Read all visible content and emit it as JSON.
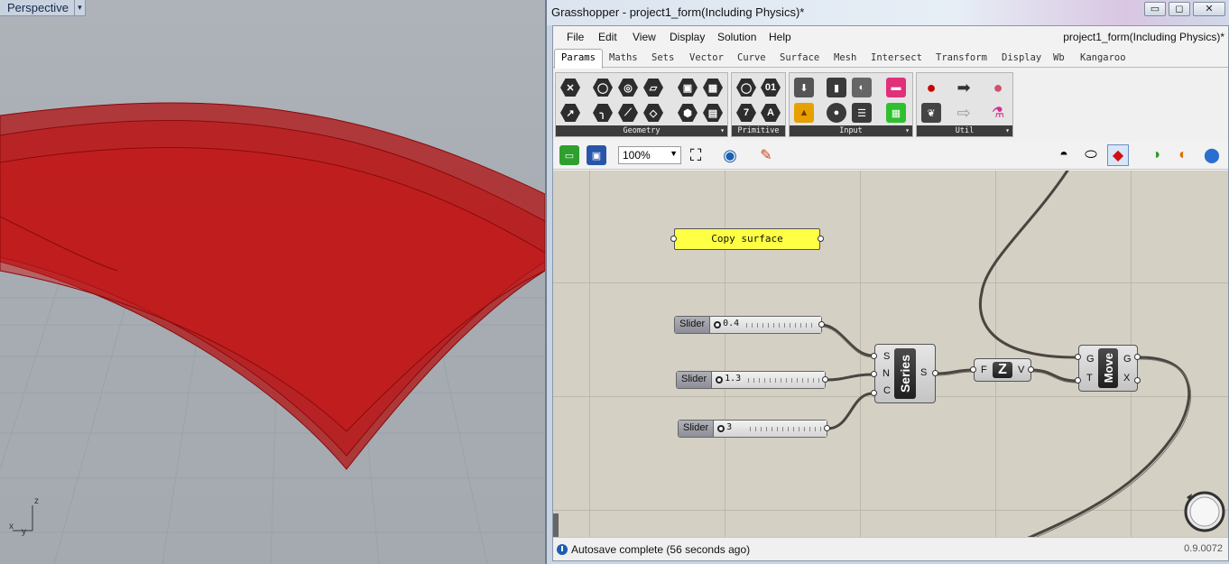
{
  "viewport": {
    "name": "Perspective",
    "dropdown_icon": "triangle-down",
    "axes": {
      "z": "z",
      "x": "x",
      "y": "y"
    },
    "surface_color": "#b01010"
  },
  "grasshopper": {
    "title": "Grasshopper - project1_form(Including Physics)*",
    "window_buttons": {
      "minimize": "▭",
      "maximize": "◻",
      "close": "✕"
    },
    "menu": [
      "File",
      "Edit",
      "View",
      "Display",
      "Solution",
      "Help"
    ],
    "document_name": "project1_form(Including Physics)*",
    "tabs": [
      "Params",
      "Maths",
      "Sets",
      "Vector",
      "Curve",
      "Surface",
      "Mesh",
      "Intersect",
      "Transform",
      "Display",
      "Wb",
      "Kangaroo"
    ],
    "active_tab": "Params",
    "panels": [
      {
        "label": "Geometry"
      },
      {
        "label": "Primitive"
      },
      {
        "label": "Input"
      },
      {
        "label": "Util"
      }
    ],
    "primitive_glyphs": {
      "a": "01",
      "b": "7",
      "c": "A"
    },
    "zoom": "100%",
    "status": "Autosave complete (56 seconds ago)",
    "version": "0.9.0072",
    "accent_color": "#ffff44"
  },
  "canvas": {
    "panel_text": "Copy surface",
    "sliders": [
      {
        "name": "Slider",
        "value": "0.4"
      },
      {
        "name": "Slider",
        "value": "1.3"
      },
      {
        "name": "Slider",
        "value": "3"
      }
    ],
    "series": {
      "title": "Series",
      "inputs": [
        "S",
        "N",
        "C"
      ],
      "output": "S"
    },
    "unit_z": {
      "input": "F",
      "core": "Z",
      "output": "V"
    },
    "move": {
      "title": "Move",
      "inputs": [
        "G",
        "T"
      ],
      "outputs": [
        "G",
        "X"
      ]
    }
  }
}
